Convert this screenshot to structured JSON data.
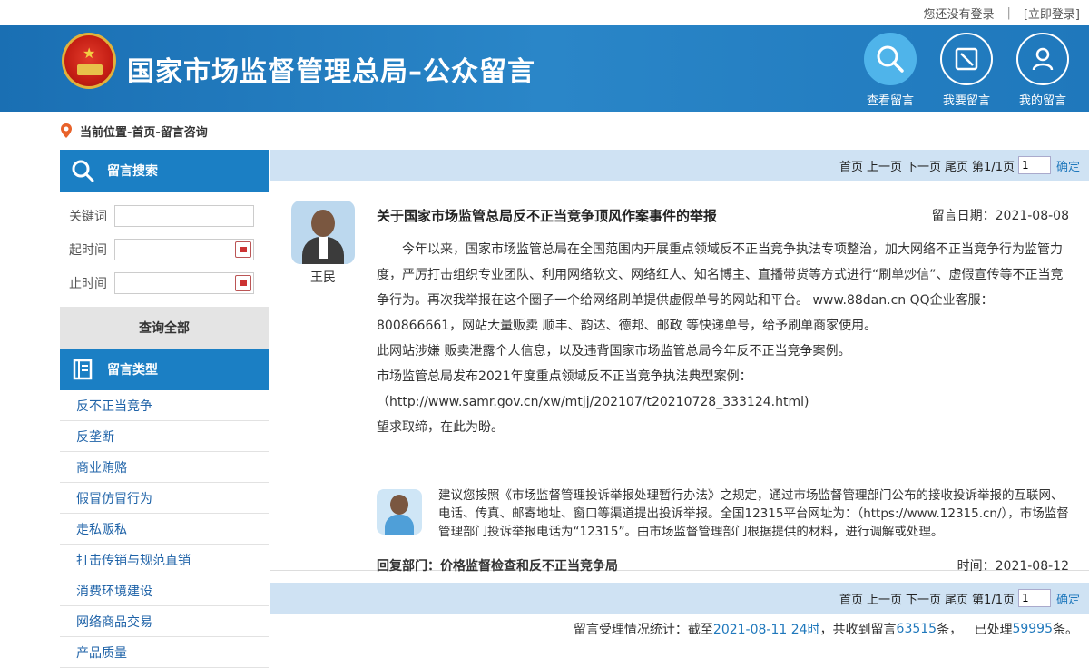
{
  "topbar": {
    "login_status": "您还没有登录",
    "separator": "|",
    "login_link": "[立即登录]"
  },
  "header": {
    "site_title": "国家市场监督管理总局–公众留言"
  },
  "nav": {
    "items": [
      {
        "label": "查看留言",
        "icon": "search-icon"
      },
      {
        "label": "我要留言",
        "icon": "compose-icon"
      },
      {
        "label": "我的留言",
        "icon": "user-icon"
      }
    ]
  },
  "breadcrumb": {
    "text": "当前位置-首页-留言咨询"
  },
  "sidebar": {
    "search_title": "留言搜索",
    "keyword_label": "关键词",
    "keyword_value": "",
    "start_label": "起时间",
    "end_label": "止时间",
    "query_all": "查询全部",
    "types_title": "留言类型",
    "categories": [
      "反不正当竞争",
      "反垄断",
      "商业贿赂",
      "假冒仿冒行为",
      "走私贩私",
      "打击传销与规范直销",
      "消费环境建设",
      "网络商品交易",
      "产品质量"
    ]
  },
  "pager": {
    "first": "首页",
    "prev": "上一页",
    "next": "下一页",
    "last": "尾页",
    "page_info": "第1/1页",
    "page_value": "1",
    "confirm": "确定"
  },
  "message": {
    "author": "王民",
    "title": "关于国家市场监管总局反不正当竞争顶风作案事件的举报",
    "date": "留言日期：2021-08-08",
    "paragraphs": [
      "　　今年以来，国家市场监管总局在全国范围内开展重点领域反不正当竞争执法专项整治，加大网络不正当竞争行为监管力度，严厉打击组织专业团队、利用网络软文、网络红人、知名博主、直播带货等方式进行“刷单炒信”、虚假宣传等不正当竞争行为。再次我举报在这个圈子一个给网络刷单提供虚假单号的网站和平台。 www.88dan.cn QQ企业客服：800866661，网站大量贩卖 顺丰、韵达、德邦、邮政 等快递单号，给予刷单商家使用。",
      "此网站涉嫌 贩卖泄露个人信息，以及违背国家市场监管总局今年反不正当竞争案例。",
      "市场监管总局发布2021年度重点领域反不正当竞争执法典型案例：（http://www.samr.gov.cn/xw/mtjj/202107/t20210728_333124.html)",
      "望求取缔，在此为盼。"
    ],
    "reply_text": "建议您按照《市场监督管理投诉举报处理暂行办法》之规定，通过市场监督管理部门公布的接收投诉举报的互联网、电话、传真、邮寄地址、窗口等渠道提出投诉举报。全国12315平台网址为：（https://www.12315.cn/），市场监督管理部门投诉举报电话为“12315”。由市场监督管理部门根据提供的材料，进行调解或处理。",
    "reply_dept": "回复部门：价格监督检查和反不正当竞争局",
    "reply_time": "时间：2021-08-12"
  },
  "stats": {
    "prefix": "留言受理情况统计：截至",
    "date": "2021-08-11 24时",
    "mid1": "，共收到留言",
    "received": "63515",
    "mid2": "条，   已处理",
    "processed": "59995",
    "suffix": "条。"
  },
  "colors": {
    "header_blue": "#1a6fb3",
    "accent_blue": "#1b7fc4",
    "pager_bg": "#cfe2f3",
    "link_blue": "#1f63a8"
  }
}
